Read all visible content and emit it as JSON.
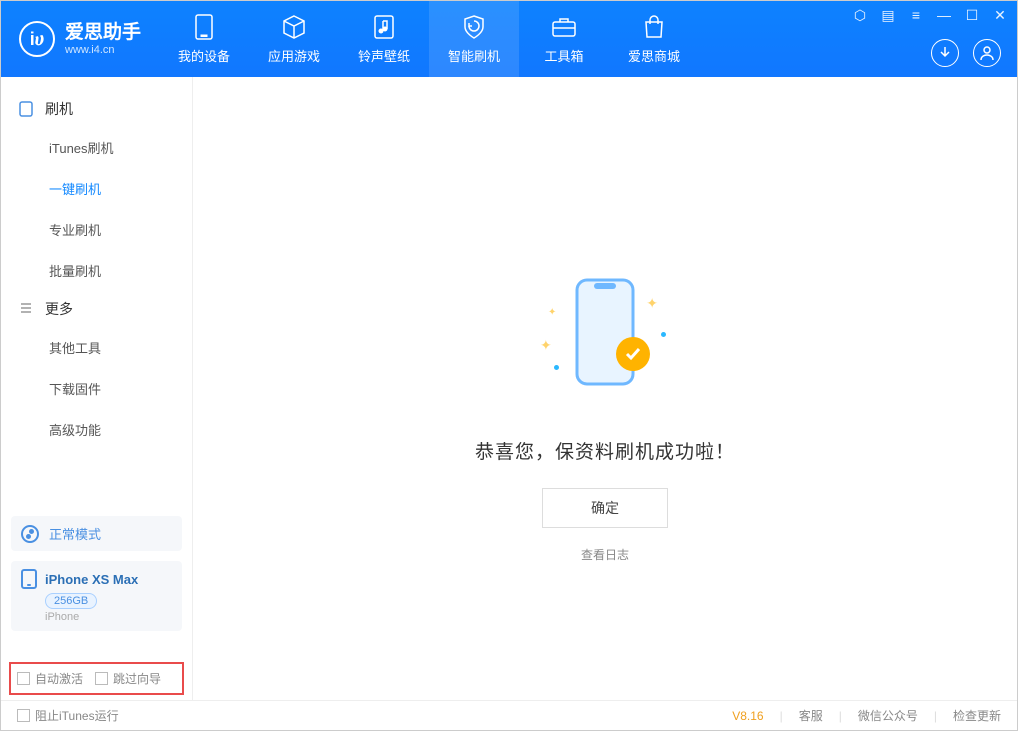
{
  "app": {
    "name": "爱思助手",
    "url": "www.i4.cn"
  },
  "nav": [
    {
      "label": "我的设备",
      "icon": "phone"
    },
    {
      "label": "应用游戏",
      "icon": "cube"
    },
    {
      "label": "铃声壁纸",
      "icon": "music"
    },
    {
      "label": "智能刷机",
      "icon": "shield",
      "active": true
    },
    {
      "label": "工具箱",
      "icon": "toolbox"
    },
    {
      "label": "爱思商城",
      "icon": "bag"
    }
  ],
  "sidebar": {
    "group1": {
      "title": "刷机",
      "items": [
        "iTunes刷机",
        "一键刷机",
        "专业刷机",
        "批量刷机"
      ],
      "activeIndex": 1
    },
    "group2": {
      "title": "更多",
      "items": [
        "其他工具",
        "下载固件",
        "高级功能"
      ]
    }
  },
  "mode": {
    "label": "正常模式"
  },
  "device": {
    "name": "iPhone XS Max",
    "capacity": "256GB",
    "type": "iPhone"
  },
  "options": {
    "auto_activate": "自动激活",
    "skip_guide": "跳过向导"
  },
  "main": {
    "message": "恭喜您，保资料刷机成功啦！",
    "ok": "确定",
    "log": "查看日志"
  },
  "footer": {
    "block_itunes": "阻止iTunes运行",
    "version": "V8.16",
    "links": [
      "客服",
      "微信公众号",
      "检查更新"
    ]
  }
}
